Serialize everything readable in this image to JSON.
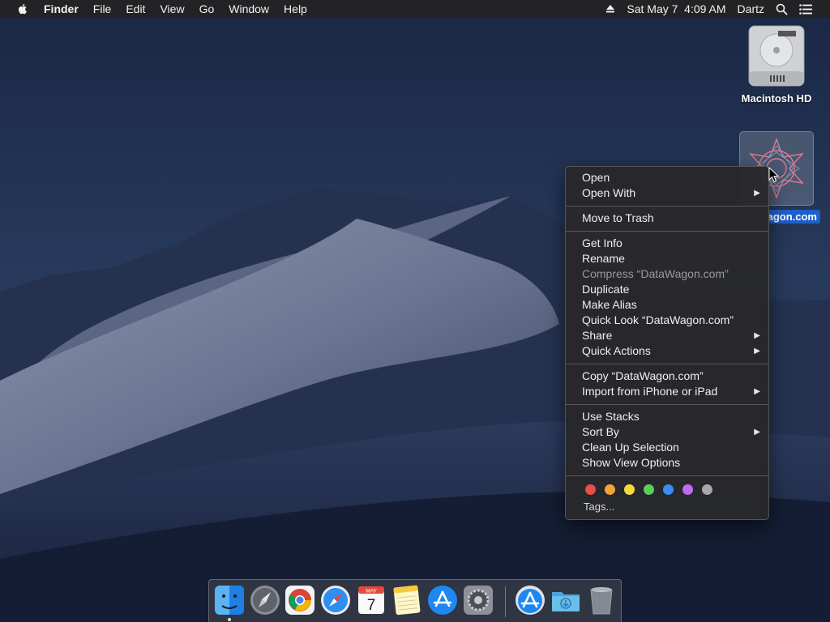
{
  "menubar": {
    "apple_icon": "apple-logo-icon",
    "app_name": "Finder",
    "menus": [
      "File",
      "Edit",
      "View",
      "Go",
      "Window",
      "Help"
    ],
    "eject_icon": "eject-icon",
    "clock": "Sat May 7  4:09 AM",
    "user": "Dartz",
    "search_icon": "spotlight-search-icon",
    "list_icon": "notification-center-icon"
  },
  "desktop": {
    "hd_label": "Macintosh HD",
    "file_label": "agon.com"
  },
  "context_menu": {
    "groups": [
      [
        {
          "label": "Open",
          "submenu": false,
          "disabled": false
        },
        {
          "label": "Open With",
          "submenu": true,
          "disabled": false
        }
      ],
      [
        {
          "label": "Move to Trash",
          "submenu": false,
          "disabled": false
        }
      ],
      [
        {
          "label": "Get Info",
          "submenu": false,
          "disabled": false
        },
        {
          "label": "Rename",
          "submenu": false,
          "disabled": false
        },
        {
          "label": "Compress “DataWagon.com”",
          "submenu": false,
          "disabled": true
        },
        {
          "label": "Duplicate",
          "submenu": false,
          "disabled": false
        },
        {
          "label": "Make Alias",
          "submenu": false,
          "disabled": false
        },
        {
          "label": "Quick Look “DataWagon.com”",
          "submenu": false,
          "disabled": false
        },
        {
          "label": "Share",
          "submenu": true,
          "disabled": false
        },
        {
          "label": "Quick Actions",
          "submenu": true,
          "disabled": false
        }
      ],
      [
        {
          "label": "Copy “DataWagon.com”",
          "submenu": false,
          "disabled": false
        },
        {
          "label": "Import from iPhone or iPad",
          "submenu": true,
          "disabled": false
        }
      ],
      [
        {
          "label": "Use Stacks",
          "submenu": false,
          "disabled": false
        },
        {
          "label": "Sort By",
          "submenu": true,
          "disabled": false
        },
        {
          "label": "Clean Up Selection",
          "submenu": false,
          "disabled": false
        },
        {
          "label": "Show View Options",
          "submenu": false,
          "disabled": false
        }
      ]
    ],
    "tag_colors": [
      "#ec4b47",
      "#f4a23a",
      "#f4d93c",
      "#56d05a",
      "#3a8df4",
      "#c06bf0",
      "#a7a7a9"
    ],
    "tags_label": "Tags..."
  },
  "dock": {
    "apps": [
      "finder-icon",
      "launchpad-icon",
      "chrome-icon",
      "safari-icon",
      "calendar-icon",
      "notes-icon",
      "app-store-icon",
      "system-preferences-icon"
    ],
    "calendar_month": "MAY",
    "calendar_day": "7",
    "right": [
      "applications-stack-icon",
      "downloads-stack-icon",
      "trash-icon"
    ]
  }
}
